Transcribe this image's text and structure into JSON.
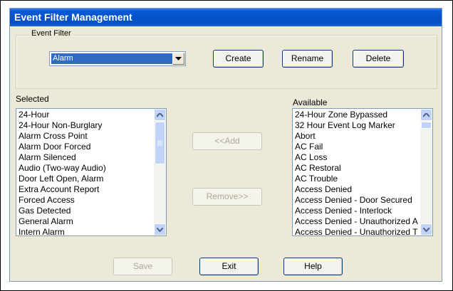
{
  "window": {
    "title": "Event Filter Management"
  },
  "event_filter": {
    "legend": "Event Filter",
    "selected_value": "Alarm",
    "create_label": "Create",
    "rename_label": "Rename",
    "delete_label": "Delete"
  },
  "selected": {
    "label": "Selected",
    "items": [
      "24-Hour",
      "24-Hour Non-Burglary",
      "Alarm Cross Point",
      "Alarm Door Forced",
      "Alarm Silenced",
      "Audio (Two-way Audio)",
      "Door Left Open, Alarm",
      "Extra Account Report",
      "Forced Access",
      "Gas Detected",
      "General Alarm",
      "Intern Alarm"
    ]
  },
  "available": {
    "label": "Available",
    "items": [
      "24-Hour Zone Bypassed",
      "32 Hour Event Log Marker",
      "Abort",
      "AC Fail",
      "AC Loss",
      "AC Restoral",
      "AC Trouble",
      "Access Denied",
      "Access Denied - Door Secured",
      "Access Denied - Interlock",
      "Access Denied - Unauthorized A",
      "Access Denied - Unauthorized T"
    ]
  },
  "actions": {
    "add_label": "<<Add",
    "remove_label": "Remove>>",
    "save_label": "Save",
    "exit_label": "Exit",
    "help_label": "Help"
  },
  "colors": {
    "title_bar": "#0552c9",
    "selection": "#316ac5",
    "window_bg": "#ece9d8"
  },
  "icons": {
    "dropdown": "chevron-down-icon",
    "scroll_up": "arrow-up-icon",
    "scroll_down": "arrow-down-icon"
  }
}
